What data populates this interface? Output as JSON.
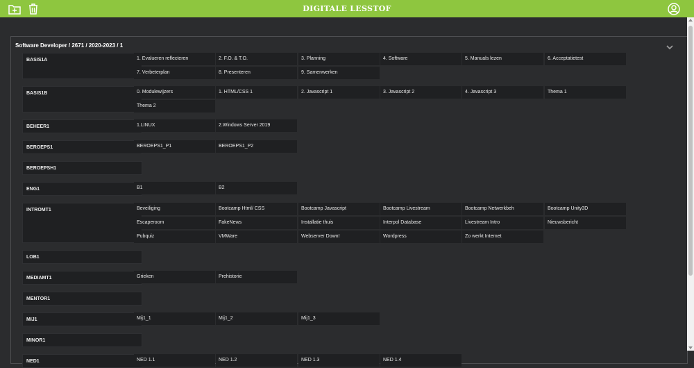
{
  "header": {
    "title": "DIGITALE LESSTOF",
    "bg_color": "#8ec63f",
    "left_icons": [
      "add-folder-icon",
      "trash-icon"
    ],
    "right_icon": "user-circle-icon"
  },
  "panel": {
    "title": "Software Developer / 2671 / 2020-2023 / 1",
    "collapse_icon": "chevron-down-icon"
  },
  "courses": [
    {
      "name": "BASIS1A",
      "items": [
        "1. Evalueren reflecteren",
        "2. F.O. & T.O.",
        "3. Planning",
        "4. Software",
        "5. Manuals lezen",
        "6. Acceptatietest",
        "7. Verbeterplan",
        "8. Presenteren",
        "9. Samenwerken"
      ]
    },
    {
      "name": "BASIS1B",
      "items": [
        "0. Modulewijzers",
        "1. HTML/CSS 1",
        "2. Javascript 1",
        "3. Javascript 2",
        "4. Javascript 3",
        "Thema 1",
        "Thema 2"
      ]
    },
    {
      "name": "BEHEER1",
      "items": [
        "1.LINUX",
        "2.Windows Server 2019"
      ]
    },
    {
      "name": "BEROEPS1",
      "items": [
        "BEROEPS1_P1",
        "BEROEPS1_P2"
      ]
    },
    {
      "name": "BEROEPSH1",
      "items": []
    },
    {
      "name": "ENG1",
      "items": [
        "B1",
        "B2"
      ]
    },
    {
      "name": "INTROMT1",
      "items": [
        "Beveiliging",
        "Bootcamp Html/ CSS",
        "Bootcamp Javascript",
        "Bootcamp Livestream",
        "Bootcamp Netwerkbeh",
        "Bootcamp Unity3D",
        "Escaperoom",
        "FakeNews",
        "Installatie thuis",
        "Interpol Database",
        "Livestream Intro",
        "Nieuwsbericht",
        "Pubquiz",
        "VMWare",
        "Webserver Down!",
        "Wordpress",
        "Zo werkt Internet"
      ]
    },
    {
      "name": "LOB1",
      "items": []
    },
    {
      "name": "MEDIAMT1",
      "items": [
        "Grieken",
        "Prehistorie"
      ]
    },
    {
      "name": "MENTOR1",
      "items": []
    },
    {
      "name": "MIJ1",
      "items": [
        "Mij1_1",
        "Mij1_2",
        "Mij1_3"
      ]
    },
    {
      "name": "MINOR1",
      "items": []
    },
    {
      "name": "NED1",
      "items": [
        "NED 1.1",
        "NED 1.2",
        "NED 1.3",
        "NED 1.4"
      ]
    }
  ]
}
